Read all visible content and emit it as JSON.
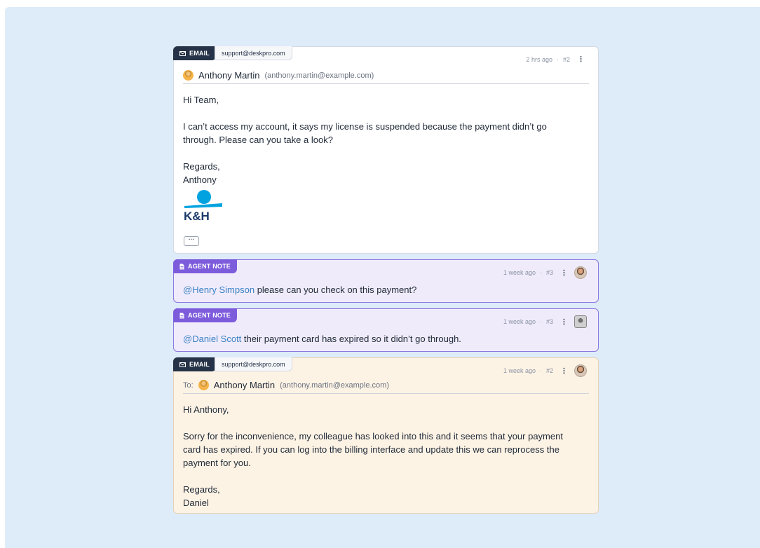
{
  "messages": [
    {
      "type_label": "EMAIL",
      "mailbox": "support@deskpro.com",
      "time": "2 hrs ago",
      "sep": "·",
      "number": "#2",
      "from_name": "Anthony Martin",
      "from_email": "(anthony.martin@example.com)",
      "greeting": "Hi Team,",
      "paragraph": "I can’t access my account, it says my license is suspended because the payment didn’t go through. Please can you take a look?",
      "signoff": "Regards,",
      "signature": "Anthony",
      "logo_text": "K&H",
      "more_label": "···"
    },
    {
      "type_label": "AGENT NOTE",
      "time": "1 week ago",
      "sep": "·",
      "number": "#3",
      "mention": "@Henry Simpson",
      "text": " please can you check on this payment?"
    },
    {
      "type_label": "AGENT NOTE",
      "time": "1 week ago",
      "sep": "·",
      "number": "#3",
      "mention": "@Daniel Scott",
      "text": " their payment card has expired so it didn’t go through."
    },
    {
      "type_label": "EMAIL",
      "mailbox": "support@deskpro.com",
      "time": "1 week ago",
      "sep": "·",
      "number": "#2",
      "to_label": "To:",
      "to_name": "Anthony Martin",
      "to_email": "(anthony.martin@example.com)",
      "greeting": "Hi Anthony,",
      "paragraph": "Sorry for the inconvenience, my colleague has looked into this and it seems that your payment card has expired. If you can log into the billing interface and update this we can reprocess the payment for you.",
      "signoff": "Regards,",
      "signature": "Daniel"
    }
  ],
  "colors": {
    "email_chip": "#253247",
    "note_chip": "#7d5cdc",
    "mention": "#3b82c4",
    "background": "#deebf9",
    "reply_bg": "#fdf3e5",
    "note_bg": "#efebfb",
    "logo_blue": "#00a3e0",
    "logo_navy": "#1a3a6b"
  },
  "icons": {
    "email_chip": "envelope-icon",
    "note_chip": "note-icon",
    "menu": "kebab-menu-icon"
  }
}
